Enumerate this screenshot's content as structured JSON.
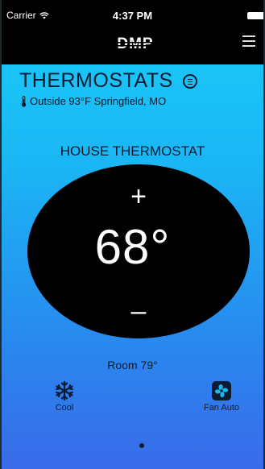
{
  "status_bar": {
    "carrier": "Carrier",
    "time": "4:37 PM"
  },
  "header": {
    "logo_text": "DMP"
  },
  "page": {
    "title": "THERMOSTATS",
    "outside_weather": "Outside 93°F Springfield, MO"
  },
  "thermostat": {
    "name": "HOUSE THERMOSTAT",
    "plus_label": "+",
    "setpoint": "68°",
    "minus_label": "–",
    "room_temp": "Room 79°",
    "mode_label": "Cool",
    "fan_label": "Fan Auto"
  },
  "pager": {
    "pages": 1,
    "current": 1
  },
  "colors": {
    "gradient_top": "#19cdf8",
    "gradient_bottom": "#3a6bea",
    "dial": "#000000",
    "text_dark": "#0d1b2e"
  },
  "icons": {
    "signal": "wifi-icon",
    "battery": "battery-icon",
    "menu": "hamburger-menu-icon",
    "list": "list-circle-icon",
    "outside": "thermometer-icon",
    "mode": "snowflake-icon",
    "fan": "fan-icon"
  }
}
